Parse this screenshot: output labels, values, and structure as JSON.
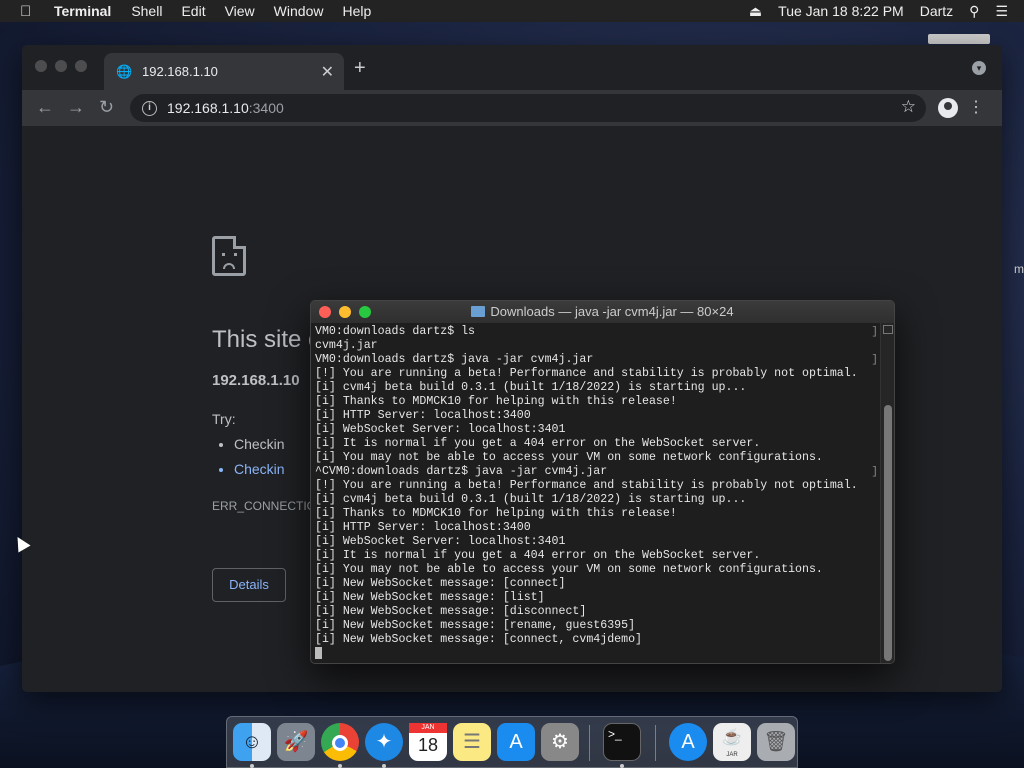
{
  "menubar": {
    "app": "Terminal",
    "items": [
      "Shell",
      "Edit",
      "View",
      "Window",
      "Help"
    ],
    "clock": "Tue Jan 18  8:22 PM",
    "user": "Dartz"
  },
  "browser": {
    "tab_title": "192.168.1.10",
    "url_host": "192.168.1.10",
    "url_port": ":3400",
    "error": {
      "title": "This site c",
      "host": "192.168.1.10",
      "try": "Try:",
      "suggestions": [
        "Checkin",
        "Checkin"
      ],
      "code": "ERR_CONNECTIO",
      "details_button": "Details"
    }
  },
  "terminal": {
    "title": "Downloads — java -jar cvm4j.jar — 80×24",
    "lines": [
      "VM0:downloads dartz$ ls",
      "cvm4j.jar",
      "VM0:downloads dartz$ java -jar cvm4j.jar",
      "[!] You are running a beta! Performance and stability is probably not optimal.",
      "[i] cvm4j beta build 0.3.1 (built 1/18/2022) is starting up...",
      "[i] Thanks to MDMCK10 for helping with this release!",
      "[i] HTTP Server: localhost:3400",
      "[i] WebSocket Server: localhost:3401",
      "[i] It is normal if you get a 404 error on the WebSocket server.",
      "[i] You may not be able to access your VM on some network configurations.",
      "^CVM0:downloads dartz$ java -jar cvm4j.jar",
      "[!] You are running a beta! Performance and stability is probably not optimal.",
      "[i] cvm4j beta build 0.3.1 (built 1/18/2022) is starting up...",
      "[i] Thanks to MDMCK10 for helping with this release!",
      "[i] HTTP Server: localhost:3400",
      "[i] WebSocket Server: localhost:3401",
      "[i] It is normal if you get a 404 error on the WebSocket server.",
      "[i] You may not be able to access your VM on some network configurations.",
      "[i] New WebSocket message: [connect]",
      "[i] New WebSocket message: [list]",
      "[i] New WebSocket message: [disconnect]",
      "[i] New WebSocket message: [rename, guest6395]",
      "[i] New WebSocket message: [connect, cvm4jdemo]"
    ]
  },
  "dock": {
    "apps": [
      "finder-icon",
      "launchpad-icon",
      "chrome-icon",
      "safari-icon",
      "calendar-icon",
      "notes-icon",
      "app-store-icon",
      "system-preferences-icon",
      "terminal-icon",
      "app-store-icon",
      "java-jar-icon",
      "trash-icon"
    ],
    "calendar_month": "JAN",
    "calendar_day": "18",
    "jar_label": "JAR"
  },
  "desktop": {
    "partial_label": "m"
  },
  "colors": {
    "link": "#8ab4f8",
    "browser_bg": "#202124",
    "terminal_bg": "#1e1e1e"
  }
}
